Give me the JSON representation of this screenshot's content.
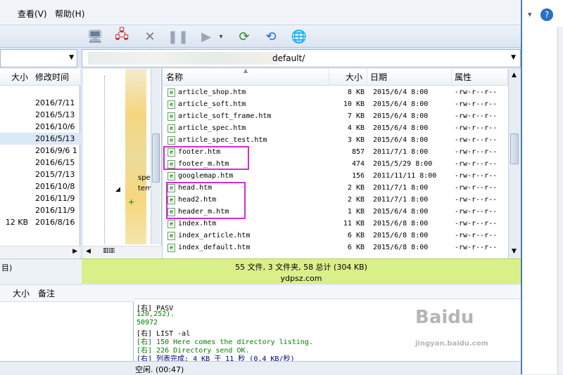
{
  "menu": {
    "view": "查看(V)",
    "help": "帮助(H)"
  },
  "local": {
    "headers": {
      "size": "大小",
      "modified": "修改时间"
    },
    "rows": [
      {
        "size": "",
        "date": "2016/7/11"
      },
      {
        "size": "",
        "date": "2016/5/13"
      },
      {
        "size": "",
        "date": "2016/10/6"
      },
      {
        "size": "",
        "date": "2016/5/13"
      },
      {
        "size": "",
        "date": "2016/9/6 1"
      },
      {
        "size": "",
        "date": "2016/6/15"
      },
      {
        "size": "",
        "date": "2015/7/13"
      },
      {
        "size": "",
        "date": "2016/10/8"
      },
      {
        "size": "",
        "date": "2016/11/9"
      },
      {
        "size": "",
        "date": "2016/11/9"
      },
      {
        "size": "12 KB",
        "date": "2016/8/16"
      }
    ],
    "status": "目)"
  },
  "remote": {
    "path": "default/",
    "headers": {
      "name": "名称",
      "size": "大小",
      "date": "日期",
      "attr": "属性"
    },
    "tree_items": [
      "spe",
      "tem"
    ],
    "files": [
      {
        "name": "article_shop.htm",
        "size": "8 KB",
        "date": "2015/6/4 8:00",
        "attr": "-rw-r--r--"
      },
      {
        "name": "article_soft.htm",
        "size": "10 KB",
        "date": "2015/6/4 8:00",
        "attr": "-rw-r--r--"
      },
      {
        "name": "article_soft_frame.htm",
        "size": "7 KB",
        "date": "2015/6/4 8:00",
        "attr": "-rw-r--r--"
      },
      {
        "name": "article_spec.htm",
        "size": "4 KB",
        "date": "2015/6/4 8:00",
        "attr": "-rw-r--r--"
      },
      {
        "name": "article_spec_test.htm",
        "size": "3 KB",
        "date": "2015/6/4 8:00",
        "attr": "-rw-r--r--"
      },
      {
        "name": "footer.htm",
        "size": "857",
        "date": "2011/7/1 8:00",
        "attr": "-rw-r--r--"
      },
      {
        "name": "footer_m.htm",
        "size": "474",
        "date": "2015/5/29 8:00",
        "attr": "-rw-r--r--"
      },
      {
        "name": "googlemap.htm",
        "size": "156",
        "date": "2011/11/11 8:00",
        "attr": "-rw-r--r--"
      },
      {
        "name": "head.htm",
        "size": "2 KB",
        "date": "2011/7/1 8:00",
        "attr": "-rw-r--r--"
      },
      {
        "name": "head2.htm",
        "size": "2 KB",
        "date": "2011/7/1 8:00",
        "attr": "-rw-r--r--"
      },
      {
        "name": "header_m.htm",
        "size": "1 KB",
        "date": "2015/6/4 8:00",
        "attr": "-rw-r--r--"
      },
      {
        "name": "index.htm",
        "size": "11 KB",
        "date": "2015/6/8 8:00",
        "attr": "-rw-r--r--"
      },
      {
        "name": "index_article.htm",
        "size": "6 KB",
        "date": "2015/6/8 8:00",
        "attr": "-rw-r--r--"
      },
      {
        "name": "index_default.htm",
        "size": "6 KB",
        "date": "2015/6/8 8:00",
        "attr": "-rw-r--r--"
      }
    ],
    "status": "55 文件, 3 文件夹, 58 总计 (304 KB)",
    "watermark": "ydpsz.com"
  },
  "queue": {
    "size": "大小",
    "note": "备注"
  },
  "log": [
    {
      "text": "[右] PASV",
      "color": "#000000"
    },
    {
      "text": "                                     120,252).",
      "color": "#008000"
    },
    {
      "text": "                                     50972",
      "color": "#008000"
    },
    {
      "text": "[右] LIST -al",
      "color": "#000000"
    },
    {
      "text": "[右] 150 Here comes the directory listing.",
      "color": "#008000"
    },
    {
      "text": "[右] 226 Directory send OK.",
      "color": "#008000"
    },
    {
      "text": "[右] 列表完成: 4 KB 于 11 秒 (0.4 KB/秒)",
      "color": "#000080"
    }
  ],
  "bottom_status": "空闲. (00:47)",
  "colors": {
    "highlight": "#d62ad6",
    "status_green": "#d9ef8a"
  }
}
